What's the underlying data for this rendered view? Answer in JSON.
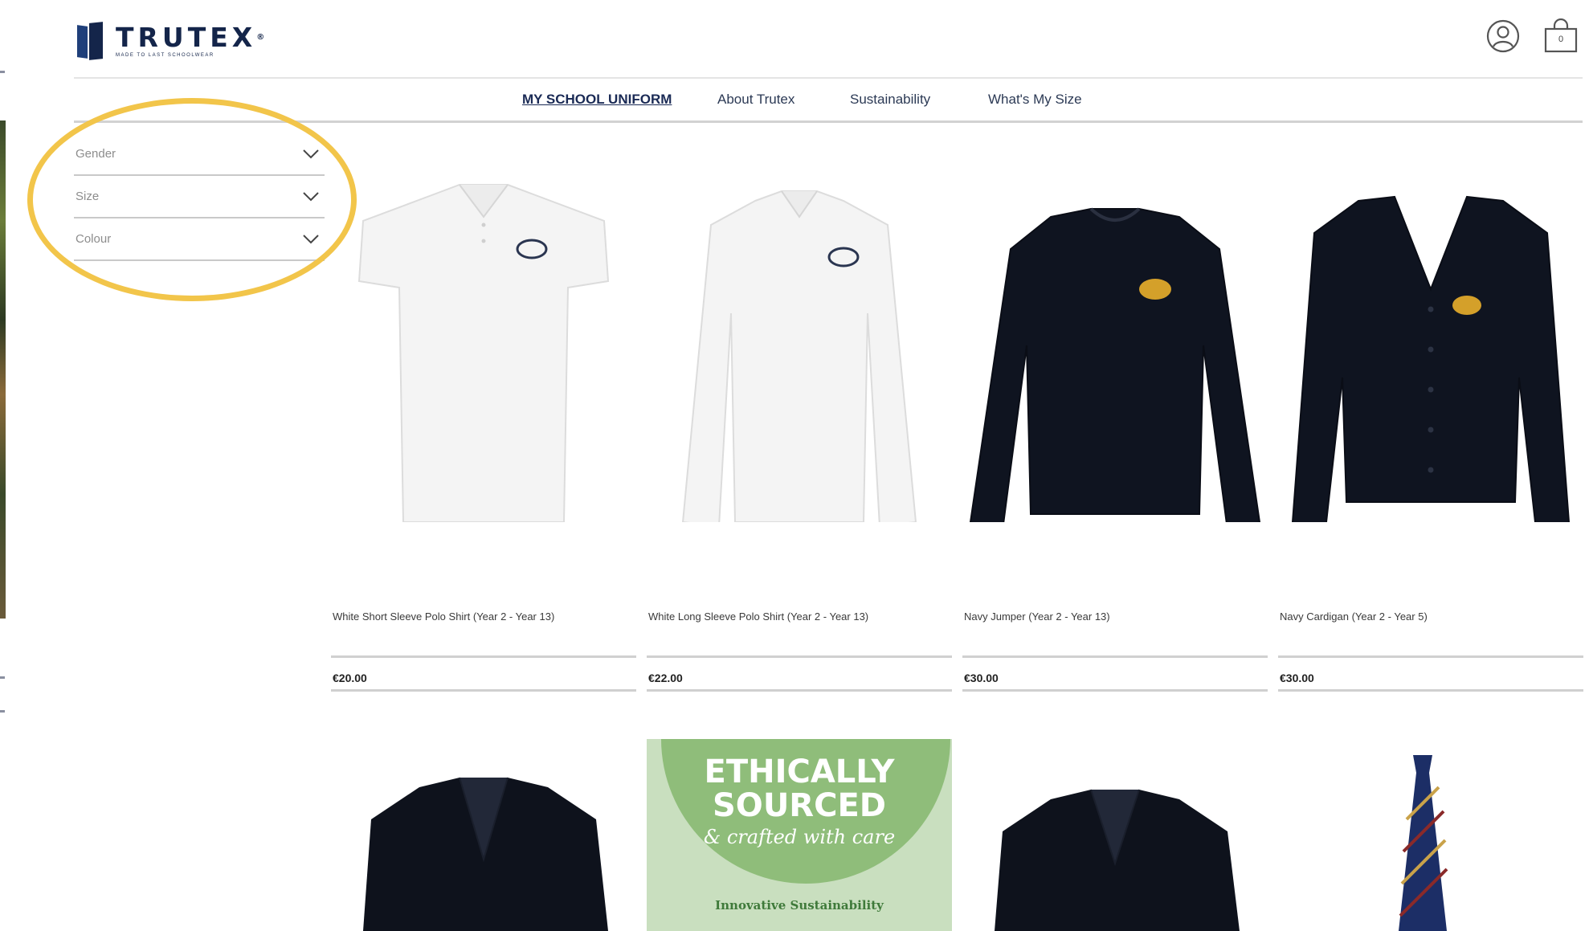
{
  "header": {
    "brand": "TRUTEX",
    "brand_mark": "®",
    "tagline": "MADE TO LAST SCHOOLWEAR",
    "icons": [
      "account-icon",
      "basket-icon"
    ],
    "basket_count": "0"
  },
  "nav": {
    "items": [
      {
        "label": "MY SCHOOL UNIFORM",
        "active": true
      },
      {
        "label": "About Trutex",
        "active": false
      },
      {
        "label": "Sustainability",
        "active": false
      },
      {
        "label": "What's My Size",
        "active": false
      }
    ]
  },
  "filters": [
    {
      "label": "Gender"
    },
    {
      "label": "Size"
    },
    {
      "label": "Colour"
    }
  ],
  "products": [
    {
      "name": "White Short Sleeve Polo Shirt (Year 2 - Year 13)",
      "price": "€20.00",
      "image": "white-short-sleeve-polo",
      "garment_color": "#f4f4f4",
      "badge_color": "#2a3550"
    },
    {
      "name": "White Long Sleeve Polo Shirt (Year 2 - Year 13)",
      "price": "€22.00",
      "image": "white-long-sleeve-polo",
      "garment_color": "#f4f4f4",
      "badge_color": "#2a3550"
    },
    {
      "name": "Navy Jumper (Year 2 - Year 13)",
      "price": "€30.00",
      "image": "navy-jumper",
      "garment_color": "#0f1420",
      "badge_color": "#d4a02a"
    },
    {
      "name": "Navy Cardigan (Year 2 - Year 5)",
      "price": "€30.00",
      "image": "navy-cardigan",
      "garment_color": "#0f1420",
      "badge_color": "#d4a02a"
    }
  ],
  "second_row": {
    "images": [
      "navy-blazer",
      "ethically-sourced-promo",
      "navy-blazer",
      "striped-tie"
    ],
    "promo": {
      "title_line1": "ETHICALLY",
      "title_line2": "SOURCED",
      "subtitle": "& crafted with care",
      "footer": "Innovative Sustainability"
    }
  },
  "colors": {
    "brand_navy": "#14254a",
    "highlight": "#f2c54a",
    "promo_green": "#8fbd7a"
  }
}
